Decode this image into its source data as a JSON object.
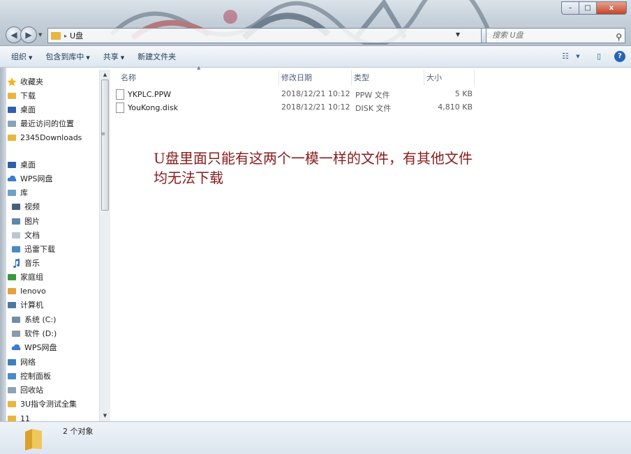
{
  "window": {
    "controls": {
      "minimize": "–",
      "maximize": "□",
      "close": "x"
    }
  },
  "address_bar": {
    "path_separator": "▸",
    "current": "U盘",
    "search_placeholder": "搜索 U盘"
  },
  "toolbar": {
    "organize": "组织",
    "include_library": "包含到库中",
    "share": "共享",
    "new_folder": "新建文件夹"
  },
  "nav_pane": {
    "items": [
      {
        "label": "收藏夹",
        "icon": "star-icon"
      },
      {
        "label": "下载",
        "icon": "download-folder-icon"
      },
      {
        "label": "桌面",
        "icon": "desktop-icon"
      },
      {
        "label": "最近访问的位置",
        "icon": "recent-places-icon"
      },
      {
        "label": "2345Downloads",
        "icon": "folder-icon"
      },
      {
        "label": "桌面",
        "icon": "desktop-icon"
      },
      {
        "label": "WPS网盘",
        "icon": "cloud-icon"
      },
      {
        "label": "库",
        "icon": "library-icon"
      },
      {
        "label": "视频",
        "icon": "video-icon"
      },
      {
        "label": "图片",
        "icon": "pictures-icon"
      },
      {
        "label": "文档",
        "icon": "documents-icon"
      },
      {
        "label": "迅雷下载",
        "icon": "thunder-download-icon"
      },
      {
        "label": "音乐",
        "icon": "music-icon"
      },
      {
        "label": "家庭组",
        "icon": "homegroup-icon"
      },
      {
        "label": "lenovo",
        "icon": "user-icon"
      },
      {
        "label": "计算机",
        "icon": "computer-icon"
      },
      {
        "label": "系统 (C:)",
        "icon": "system-drive-icon"
      },
      {
        "label": "软件 (D:)",
        "icon": "drive-icon"
      },
      {
        "label": "WPS网盘",
        "icon": "cloud-icon"
      },
      {
        "label": "网络",
        "icon": "network-icon"
      },
      {
        "label": "控制面板",
        "icon": "control-panel-icon"
      },
      {
        "label": "回收站",
        "icon": "recycle-bin-icon"
      },
      {
        "label": "3U指令测试全集",
        "icon": "folder-icon"
      },
      {
        "label": "11",
        "icon": "folder-icon"
      }
    ]
  },
  "file_list": {
    "columns": [
      "名称",
      "修改日期",
      "类型",
      "大小"
    ],
    "rows": [
      {
        "name": "YKPLC.PPW",
        "modified": "2018/12/21 10:12",
        "type": "PPW 文件",
        "size": "5 KB"
      },
      {
        "name": "YouKong.disk",
        "modified": "2018/12/21 10:12",
        "type": "DISK 文件",
        "size": "4,810 KB"
      }
    ]
  },
  "annotation": {
    "line1": "U盘里面只能有这两个一模一样的文件，有其他文件",
    "line2": "均无法下载"
  },
  "status": {
    "item_count": "2 个对象"
  },
  "colors": {
    "annotation_text": "#8b1a1a",
    "toolbar_text": "#1e395b",
    "folder_yellow": "#e8b63e"
  }
}
